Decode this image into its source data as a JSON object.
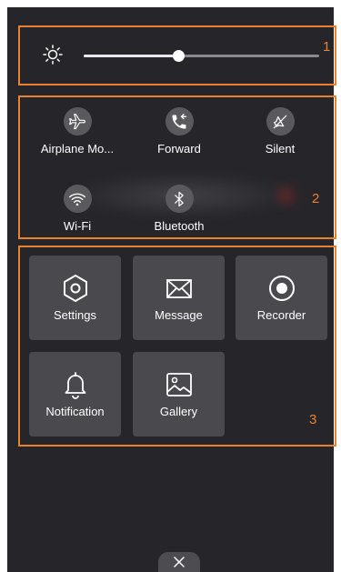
{
  "brightness": {
    "icon": "sun-icon",
    "level_percent": 40
  },
  "section_labels": [
    "1",
    "2",
    "3"
  ],
  "toggles": [
    {
      "label": "Airplane Mo...",
      "icon": "airplane-icon"
    },
    {
      "label": "Forward",
      "icon": "call-forward-icon"
    },
    {
      "label": "Silent",
      "icon": "silent-icon"
    },
    {
      "label": "Wi-Fi",
      "icon": "wifi-icon"
    },
    {
      "label": "Bluetooth",
      "icon": "bluetooth-icon"
    }
  ],
  "tiles": [
    {
      "label": "Settings",
      "icon": "settings-icon"
    },
    {
      "label": "Message",
      "icon": "message-icon"
    },
    {
      "label": "Recorder",
      "icon": "recorder-icon"
    },
    {
      "label": "Notification",
      "icon": "bell-icon"
    },
    {
      "label": "Gallery",
      "icon": "gallery-icon"
    }
  ],
  "close": {
    "icon": "close-icon"
  },
  "colors": {
    "accent": "#e8822f",
    "panel": "#26262a",
    "tile": "#4a4a4e",
    "toggle": "#5a5a5e"
  }
}
